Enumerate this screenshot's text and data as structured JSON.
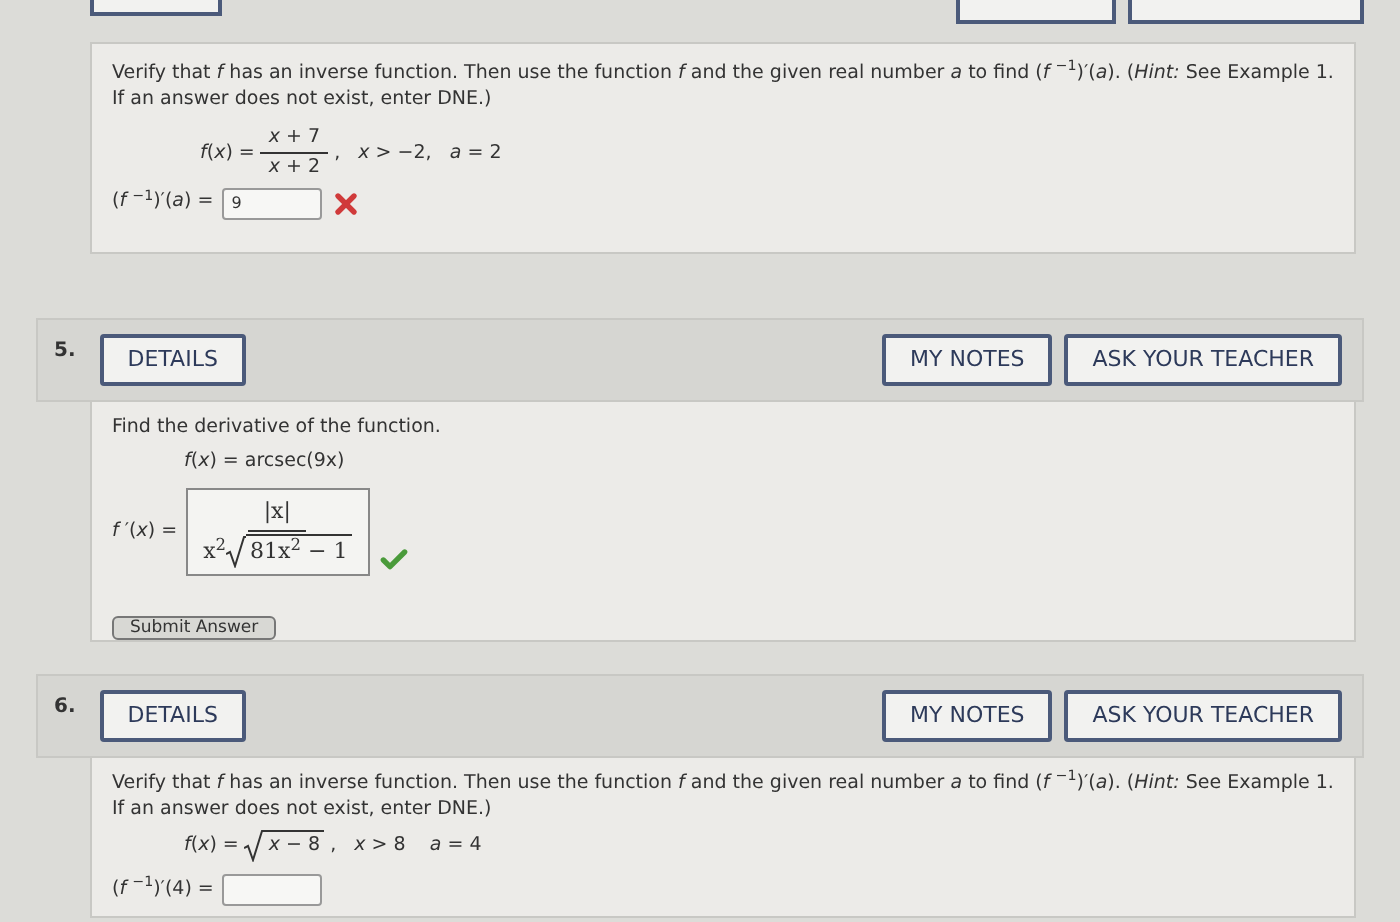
{
  "previous_question": {
    "prompt": "Verify that *f* has an inverse function. Then use the function *f* and the given real number *a* to find (*f* $^{−1}$)′(*a*). (*Hint:* See Example 1. If an answer does not exist, enter DNE.)",
    "function_lhs": "*f*(*x*) =",
    "numerator": "*x* + 7",
    "denominator": "*x* + 2",
    "condition": ",   *x* > −2,   *a* = 2",
    "answer_label": "(*f* $^{−1}$)′(*a*) =",
    "answer_value": "9",
    "correct": false
  },
  "questions": [
    {
      "number": "5.",
      "buttons": [
        "DETAILS",
        "MY NOTES",
        "ASK YOUR TEACHER"
      ],
      "prompt": "Find the derivative of the function.",
      "function": "*f*(*x*) = arcsec(9x)",
      "answer_label": "*f* ′(*x*) =",
      "answer": {
        "kind": "fraction",
        "numerator": "|x|",
        "factor": "x$^{2}$",
        "radicand": "81x$^{2}$ − 1"
      },
      "correct": true,
      "submit": "Submit Answer"
    },
    {
      "number": "6.",
      "buttons": [
        "DETAILS",
        "MY NOTES",
        "ASK YOUR TEACHER"
      ],
      "prompt": "Verify that *f* has an inverse function. Then use the function *f* and the given real number *a* to find (*f* $^{−1}$)′(*a*). (*Hint:* See Example 1. If an answer does not exist, enter DNE.)",
      "function": "*f*(*x*) =",
      "radicand": "*x* − 8",
      "condition": ",   *x* > 8    *a* = 4",
      "answer_label": "(*f* $^{−1}$)′(4) =",
      "answer": {
        "kind": "field"
      }
    }
  ]
}
